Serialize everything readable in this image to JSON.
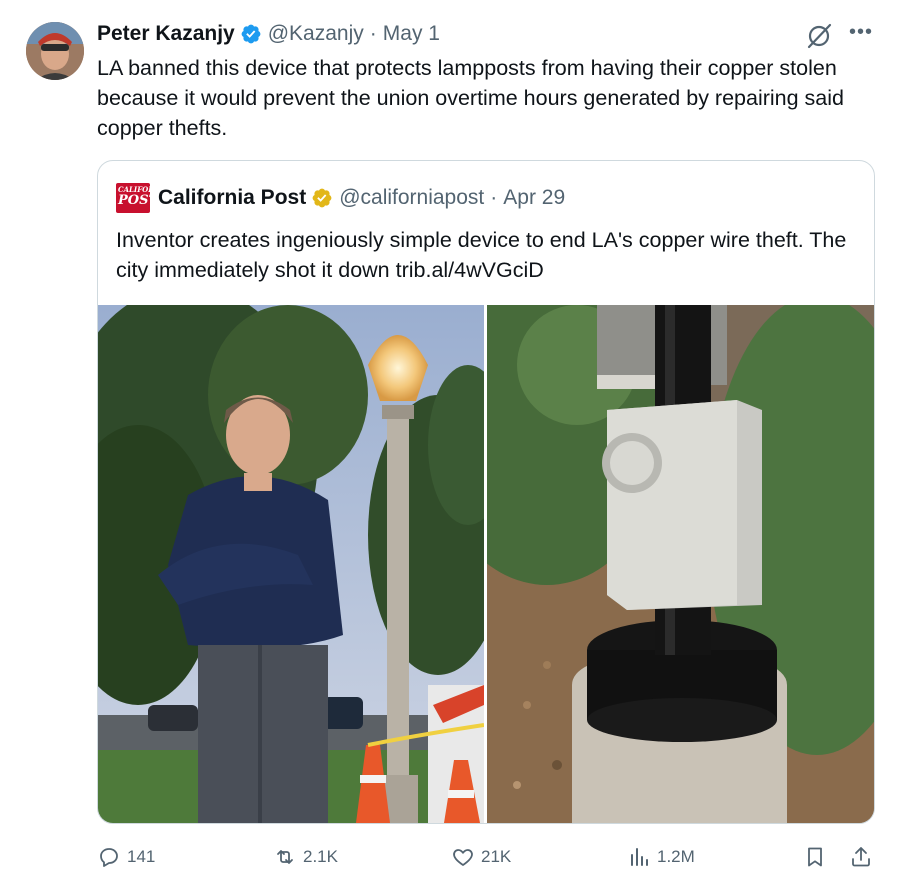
{
  "post": {
    "author_name": "Peter Kazanjy",
    "handle": "@Kazanjy",
    "separator": "·",
    "date": "May 1",
    "text": "LA banned this device that protects lampposts from having their copper stolen because it would prevent the union overtime hours generated by repairing said copper thefts."
  },
  "quote": {
    "logo_line1": "CALIFORNIA",
    "logo_line2": "POST",
    "author_name": "California Post",
    "handle": "@californiapost",
    "separator": "·",
    "date": "Apr 29",
    "text": "Inventor creates ingeniously simple device to end LA's copper wire theft. The city immediately shot it down trib.al/4wVGciD"
  },
  "actions": {
    "replies": "141",
    "reposts": "2.1K",
    "likes": "21K",
    "views": "1.2M"
  },
  "icons": {
    "verified": "verified-badge-icon",
    "gold_verified": "gold-verified-badge-icon",
    "grok": "grok-icon",
    "more": "more-icon",
    "reply": "reply-icon",
    "repost": "repost-icon",
    "like": "heart-icon",
    "views": "views-icon",
    "bookmark": "bookmark-icon",
    "share": "share-icon"
  },
  "colors": {
    "text": "#0f1419",
    "muted": "#536471",
    "verified_blue": "#1d9bf0",
    "verified_gold": "#e2b719",
    "border": "#cfd9de",
    "logo_red": "#c8102e"
  }
}
